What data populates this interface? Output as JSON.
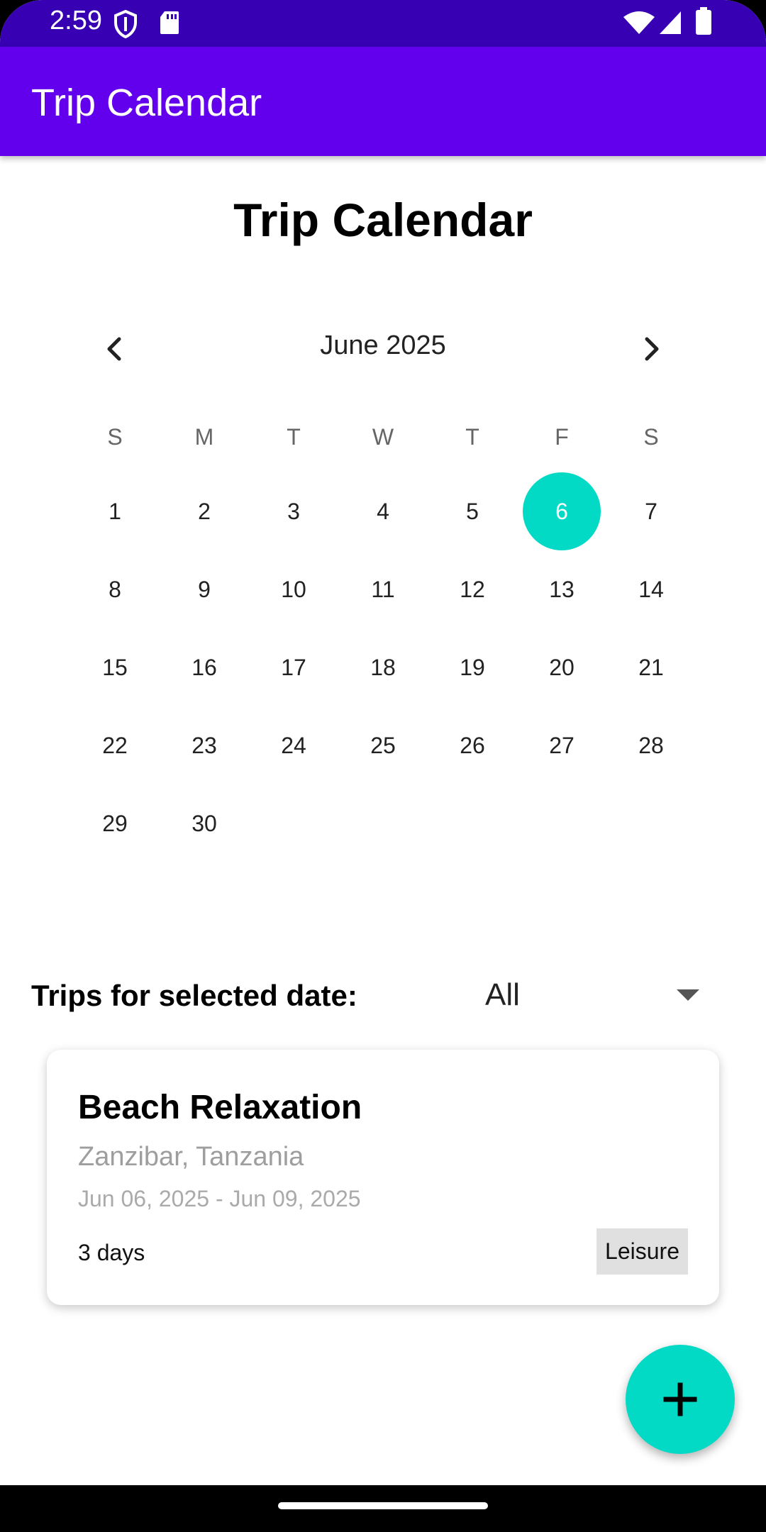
{
  "status_bar": {
    "time": "2:59",
    "icons": [
      "shield-icon",
      "sd-card-icon",
      "wifi-icon",
      "signal-icon",
      "battery-icon"
    ]
  },
  "app_bar": {
    "title": "Trip Calendar"
  },
  "page": {
    "title": "Trip Calendar"
  },
  "calendar": {
    "month_label": "June 2025",
    "weekdays": [
      "S",
      "M",
      "T",
      "W",
      "T",
      "F",
      "S"
    ],
    "days": [
      "1",
      "2",
      "3",
      "4",
      "5",
      "6",
      "7",
      "8",
      "9",
      "10",
      "11",
      "12",
      "13",
      "14",
      "15",
      "16",
      "17",
      "18",
      "19",
      "20",
      "21",
      "22",
      "23",
      "24",
      "25",
      "26",
      "27",
      "28",
      "29",
      "30"
    ],
    "selected_day": "6",
    "accent_color": "#03dac5"
  },
  "trips_section": {
    "label": "Trips for selected date:",
    "filter_value": "All"
  },
  "trips": [
    {
      "name": "Beach Relaxation",
      "location": "Zanzibar, Tanzania",
      "dates": "Jun 06, 2025 - Jun 09, 2025",
      "duration": "3 days",
      "category": "Leisure"
    }
  ],
  "fab": {
    "icon": "plus-icon"
  },
  "colors": {
    "primary": "#6200ee",
    "primary_dark": "#3700b3",
    "secondary": "#03dac5"
  }
}
